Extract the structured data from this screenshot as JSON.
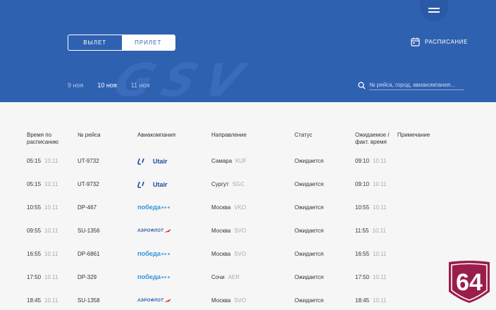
{
  "header": {
    "direction_toggle": {
      "departure_label": "ВЫЛЕТ",
      "arrival_label": "ПРИЛЕТ",
      "active": "arrival"
    },
    "schedule_label": "РАСПИСАНИЕ",
    "dates": [
      "9 ноя",
      "10 ноя",
      "11 ноя"
    ],
    "selected_date": "10 ноя",
    "search": {
      "placeholder": "№ рейса, город, авиакомпания...",
      "value": ""
    }
  },
  "table": {
    "columns": {
      "scheduled_line1": "Время по",
      "scheduled_line2": "расписанию",
      "flight": "№ рейса",
      "airline": "Авиакомпания",
      "direction": "Направление",
      "status": "Статус",
      "expected_line1": "Ожидаемое /",
      "expected_line2": "факт. время",
      "note": "Примечание"
    },
    "rows": [
      {
        "time": "05:15",
        "date": "10.11",
        "flight": "UT-9732",
        "airline": "Utair",
        "city": "Самара",
        "code": "KUF",
        "status": "Ожидается",
        "exp_time": "09:10",
        "exp_date": "10.11"
      },
      {
        "time": "05:15",
        "date": "10.11",
        "flight": "UT-9732",
        "airline": "Utair",
        "city": "Сургут",
        "code": "SGC",
        "status": "Ожидается",
        "exp_time": "09:10",
        "exp_date": "10.11"
      },
      {
        "time": "10:55",
        "date": "10.11",
        "flight": "DP-467",
        "airline": "победа",
        "city": "Москва",
        "code": "VKO",
        "status": "Ожидается",
        "exp_time": "10:55",
        "exp_date": "10.11"
      },
      {
        "time": "09:55",
        "date": "10.11",
        "flight": "SU-1356",
        "airline": "АЭРОФЛОТ",
        "city": "Москва",
        "code": "SVO",
        "status": "Ожидается",
        "exp_time": "11:55",
        "exp_date": "10.11"
      },
      {
        "time": "16:55",
        "date": "10.11",
        "flight": "DP-6861",
        "airline": "победа",
        "city": "Москва",
        "code": "SVO",
        "status": "Ожидается",
        "exp_time": "16:55",
        "exp_date": "10.11"
      },
      {
        "time": "17:50",
        "date": "10.11",
        "flight": "DP-329",
        "airline": "победа",
        "city": "Сочи",
        "code": "AER",
        "status": "Ожидается",
        "exp_time": "17:50",
        "exp_date": "10.11"
      },
      {
        "time": "18:45",
        "date": "10.11",
        "flight": "SU-1358",
        "airline": "АЭРОФЛОТ",
        "city": "Москва",
        "code": "SVO",
        "status": "Ожидается",
        "exp_time": "18:45",
        "exp_date": "10.11"
      }
    ]
  },
  "watermark": "GSV",
  "badge": {
    "label": "64",
    "color": "#9b1d4b"
  },
  "colors": {
    "header_bg": "#2f61b1",
    "page_bg": "#f6f6f6",
    "utair": "#1a4a9c",
    "pobeda": "#3a97d8",
    "aeroflot": "#2a56a6",
    "aeroflot_accent": "#e0232f"
  }
}
